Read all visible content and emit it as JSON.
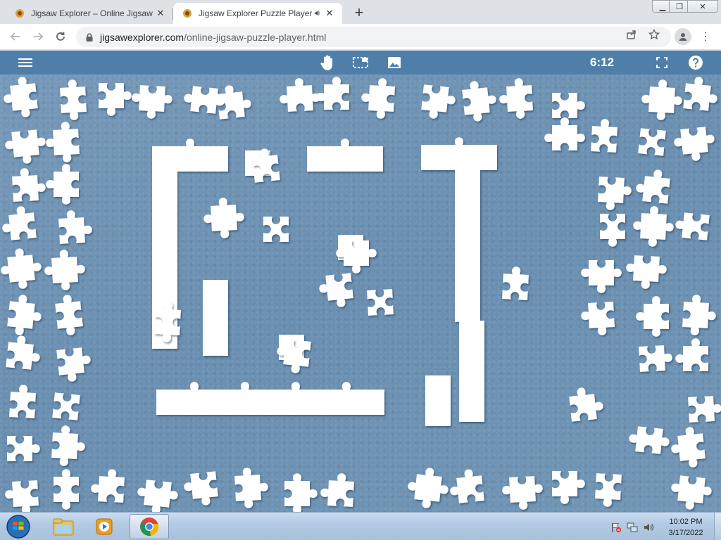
{
  "browser": {
    "tabs": [
      {
        "title": "Jigsaw Explorer – Online Jigsaw P",
        "active": false
      },
      {
        "title": "Jigsaw Explorer Puzzle Player",
        "active": true,
        "audio": true
      }
    ],
    "url_host": "jigsawexplorer.com",
    "url_path": "/online-jigsaw-puzzle-player.html"
  },
  "app": {
    "timer": "6:12",
    "icons": [
      "menu-icon",
      "hand-icon",
      "selection-box-icon",
      "image-preview-icon",
      "fullscreen-icon",
      "help-icon"
    ],
    "colors": {
      "bar": "#4f7fa8",
      "board": "#6f93b4",
      "piece": "#ffffff"
    }
  },
  "taskbar": {
    "pinned": [
      "windows-explorer-icon",
      "media-player-icon",
      "chrome-icon"
    ],
    "clock_time": "10:02 PM",
    "clock_date": "3/17/2022"
  }
}
